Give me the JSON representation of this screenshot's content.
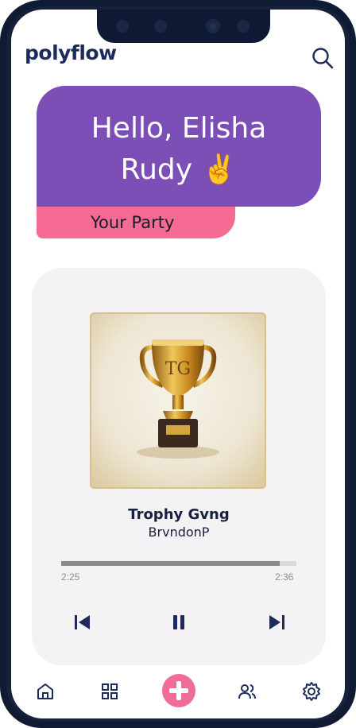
{
  "app": {
    "brand": "polyflow"
  },
  "greeting": {
    "line1": "Hello, Elisha",
    "line2": "Rudy ✌️",
    "section_label": "Your Party"
  },
  "player": {
    "title": "Trophy Gvng",
    "artist": "BrvndonP",
    "current_time": "2:25",
    "total_time": "2:36",
    "progress": 0.93
  },
  "icons": {
    "search": "search-icon",
    "prev": "skip-previous-icon",
    "pause": "pause-icon",
    "next": "skip-next-icon",
    "home": "home-icon",
    "grid": "grid-icon",
    "add": "plus-icon",
    "users": "users-icon",
    "settings": "gear-icon"
  },
  "colors": {
    "brand": "#1d2b5a",
    "greeting_bg": "#7b4fb6",
    "accent_pink": "#f56b93",
    "card_bg": "#f4f2f5"
  }
}
